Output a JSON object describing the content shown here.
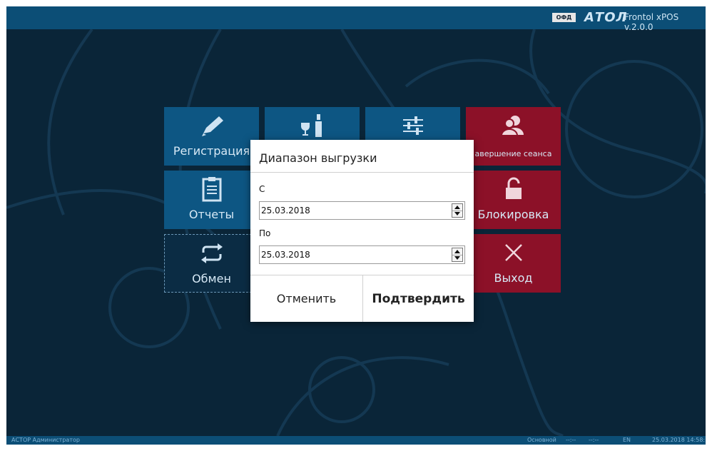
{
  "topbar": {
    "ofd_badge": "ОФД",
    "logo": "АТОЛ",
    "app_title": "Frontol xPOS v.2.0.0"
  },
  "tiles": {
    "registration": "Регистрация",
    "reports": "Отчеты",
    "exchange": "Обмен",
    "end_session": "авершение сеанса",
    "lock": "Блокировка",
    "exit": "Выход"
  },
  "dialog": {
    "title": "Диапазон выгрузки",
    "from_label": "С",
    "from_value": "25.03.2018",
    "to_label": "По",
    "to_value": "25.03.2018",
    "cancel_label": "Отменить",
    "confirm_label": "Подтвердить"
  },
  "statusbar": {
    "user": "АСТОР  Администратор",
    "mode": "Основной",
    "indicator1": "--:--",
    "indicator2": "--:--",
    "lang": "EN",
    "datetime": "25.03.2018 14:58:"
  },
  "colors": {
    "tile_blue": "#0d5683",
    "tile_red": "#8c1128",
    "background": "#0a2538",
    "bar": "#0c4e76"
  }
}
